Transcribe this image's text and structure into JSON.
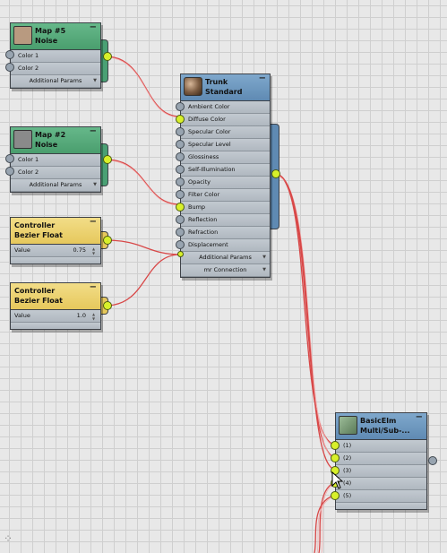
{
  "nodes": {
    "map5": {
      "line1": "Map #5",
      "line2": "Noise",
      "rows": [
        "Color 1",
        "Color 2"
      ],
      "params": "Additional Params",
      "color": "#b89a80"
    },
    "map2": {
      "line1": "Map #2",
      "line2": "Noise",
      "rows": [
        "Color 1",
        "Color 2"
      ],
      "params": "Additional Params",
      "color": "#8a8a8a"
    },
    "ctrl1": {
      "line1": "Controller",
      "line2": "Bezier Float",
      "value_label": "Value",
      "value": "0.75"
    },
    "ctrl2": {
      "line1": "Controller",
      "line2": "Bezier Float",
      "value_label": "Value",
      "value": "1.0"
    },
    "trunk": {
      "line1": "Trunk",
      "line2": "Standard",
      "rows": [
        "Ambient Color",
        "Diffuse Color",
        "Specular Color",
        "Specular Level",
        "Glossiness",
        "Self-Illumination",
        "Opacity",
        "Filter Color",
        "Bump",
        "Reflection",
        "Refraction",
        "Displacement"
      ],
      "params": "Additional Params",
      "connection": "mr Connection"
    },
    "basic": {
      "line1": "BasicElm",
      "line2": "Multi/Sub-...",
      "rows": [
        "(1)",
        "(2)",
        "(3)",
        "(4)",
        "(5)"
      ]
    }
  },
  "colors": {
    "wire": "#d84848",
    "socket_active": "#d8f02a",
    "socket_inactive": "#98a4b0"
  }
}
